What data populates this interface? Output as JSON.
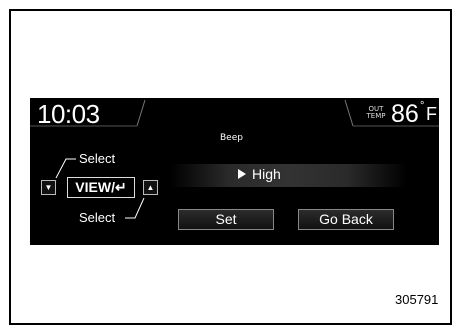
{
  "status_bar": {
    "clock": "10:03",
    "out_temp_label_line1": "OUT",
    "out_temp_label_line2": "TEMP",
    "temperature": "86",
    "degree_symbol": "°",
    "unit": "F"
  },
  "screen": {
    "title": "Beep",
    "selected_option": "High",
    "buttons": {
      "set": "Set",
      "go_back": "Go Back"
    }
  },
  "controls": {
    "select_top_label": "Select",
    "select_bottom_label": "Select",
    "view_button_label": "VIEW/↵",
    "down_arrow": "▼",
    "up_arrow": "▲"
  },
  "figure": {
    "caption": "305791"
  }
}
